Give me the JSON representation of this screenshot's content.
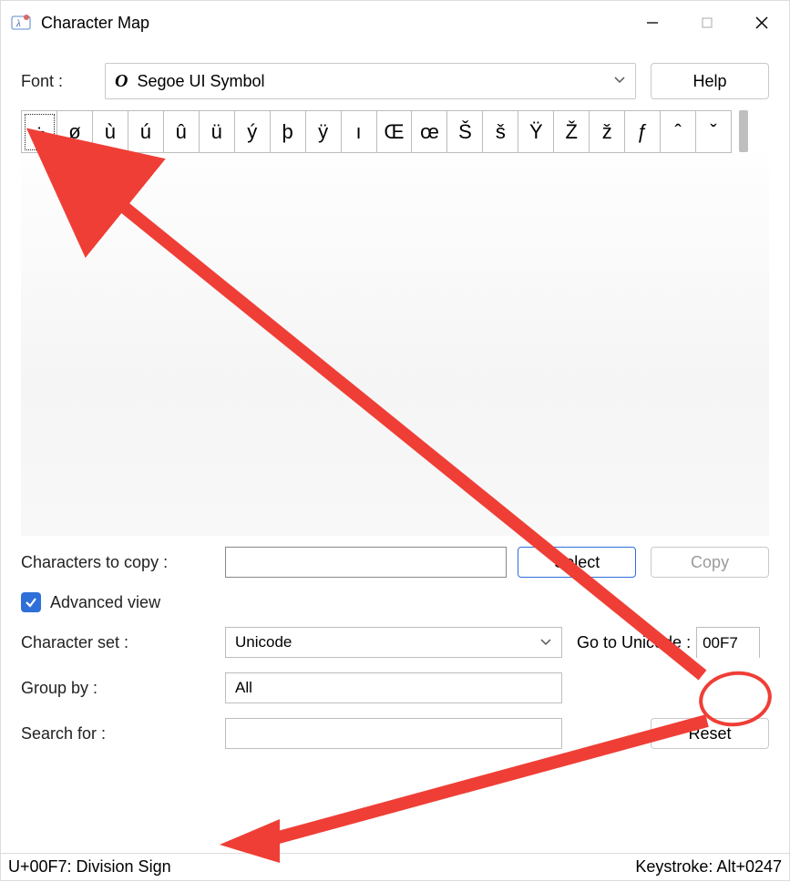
{
  "window": {
    "title": "Character Map"
  },
  "font": {
    "label": "Font :",
    "icon_glyph": "O",
    "selected": "Segoe UI Symbol",
    "help_label": "Help"
  },
  "grid": {
    "selected_index": 0,
    "chars": [
      "÷",
      "ø",
      "ù",
      "ú",
      "û",
      "ü",
      "ý",
      "þ",
      "ÿ",
      "ı",
      "Œ",
      "œ",
      "Š",
      "š",
      "Ÿ",
      "Ž",
      "ž",
      "ƒ",
      "ˆ",
      "ˇ"
    ]
  },
  "copy": {
    "label": "Characters to copy :",
    "value": "",
    "select_label": "Select",
    "copy_label": "Copy"
  },
  "advanced": {
    "checked": true,
    "label": "Advanced view"
  },
  "charset": {
    "label": "Character set :",
    "value": "Unicode",
    "goto_label": "Go to Unicode :",
    "goto_value": "00F7"
  },
  "group": {
    "label": "Group by :",
    "value": "All"
  },
  "search": {
    "label": "Search for :",
    "value": "",
    "reset_label": "Reset"
  },
  "status": {
    "left": "U+00F7: Division Sign",
    "right": "Keystroke: Alt+0247"
  },
  "annotations": {
    "color": "#ef3e36"
  }
}
